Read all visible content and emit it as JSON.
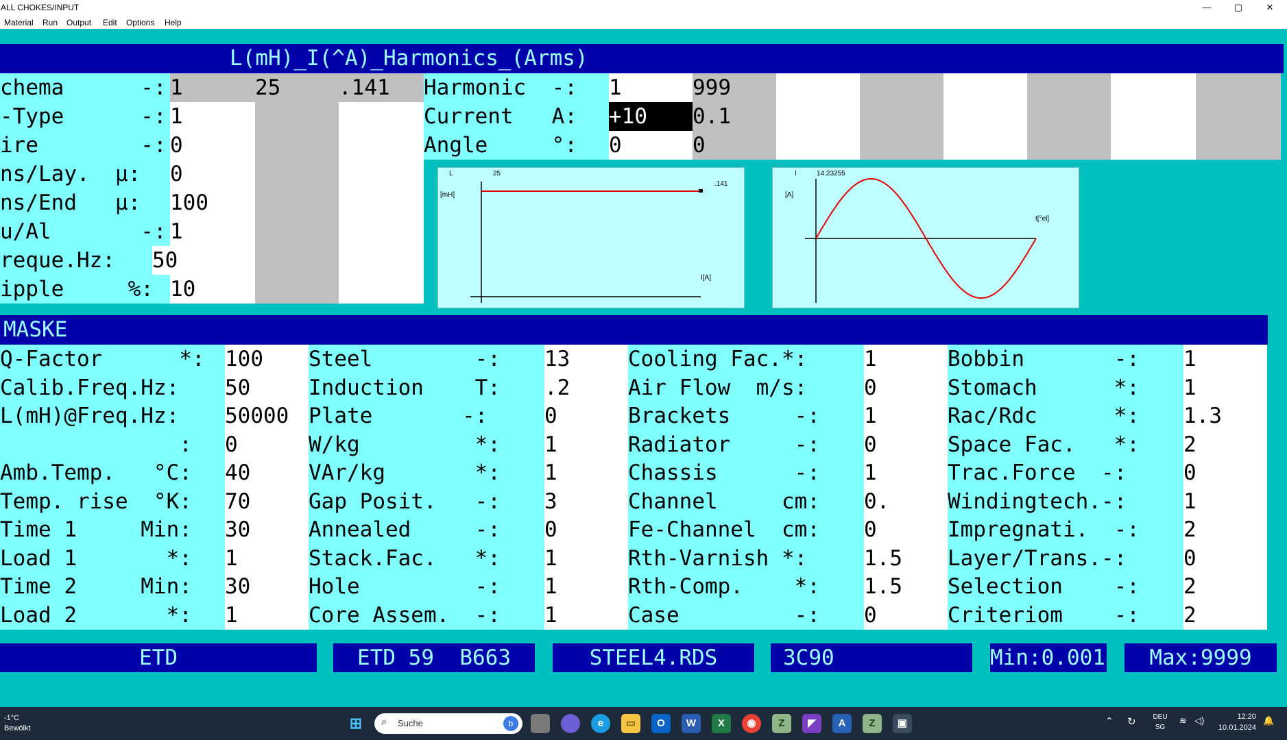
{
  "window": {
    "title": "ALL CHOKES/INPUT",
    "minimize": "—",
    "maximize": "▢",
    "close": "✕"
  },
  "menu": [
    "Material",
    "Run",
    "Output",
    "Edit",
    "Options",
    "Help"
  ],
  "top_section": {
    "title": "L(mH)_I(^A)_Harmonics_(Arms)",
    "rows": [
      {
        "label": "chema      -:",
        "v1": "1",
        "v2": "25",
        "v3": ".141"
      },
      {
        "label": "-Type      -:",
        "v1": "1",
        "v2": "",
        "v3": ""
      },
      {
        "label": "ire        -:",
        "v1": "0",
        "v2": "",
        "v3": ""
      },
      {
        "label": "ns/Lay.  µ:",
        "v1": "0",
        "v2": "",
        "v3": ""
      },
      {
        "label": "ns/End   µ:",
        "v1": "100",
        "v2": "",
        "v3": ""
      },
      {
        "label": "u/Al       -:",
        "v1": "1",
        "v2": "",
        "v3": ""
      },
      {
        "label": "reque.Hz:",
        "v1": "50",
        "v2": "",
        "v3": ""
      },
      {
        "label": "ipple     %:",
        "v1": "10",
        "v2": "",
        "v3": ""
      }
    ],
    "harmonic_rows": [
      {
        "label": "Harmonic  -:",
        "v1": "1",
        "v2": "999"
      },
      {
        "label": "Current   A:",
        "v1": "+10",
        "v2": "0.1"
      },
      {
        "label": "Angle     °:",
        "v1": "0",
        "v2": "0"
      }
    ]
  },
  "charts": {
    "inductance": {
      "ylabel_top": "L",
      "ylabel_unit": "[mH]",
      "top_value": "25",
      "end_value": ".141",
      "xlabel": "I[A]"
    },
    "current": {
      "ylabel_top": "I",
      "ylabel_unit": "[A]",
      "peak_value": "14.23255",
      "xlabel": "t[°el]"
    }
  },
  "mask_section": {
    "title": "MASKE",
    "col1": [
      {
        "label": "Q-Factor      *:",
        "value": "100"
      },
      {
        "label": "Calib.Freq.Hz:",
        "value": "50"
      },
      {
        "label": "L(mH)@Freq.Hz:",
        "value": "50000"
      },
      {
        "label": "              :",
        "value": "0"
      },
      {
        "label": "Amb.Temp.   °C:",
        "value": "40"
      },
      {
        "label": "Temp. rise  °K:",
        "value": "70"
      },
      {
        "label": "Time 1     Min:",
        "value": "30"
      },
      {
        "label": "Load 1       *:",
        "value": "1"
      },
      {
        "label": "Time 2     Min:",
        "value": "30"
      },
      {
        "label": "Load 2       *:",
        "value": "1"
      }
    ],
    "col2": [
      {
        "label": "Steel        -:",
        "value": "13"
      },
      {
        "label": "Induction    T:",
        "value": ".2"
      },
      {
        "label": "Plate       -:",
        "value": "0"
      },
      {
        "label": "W/kg         *:",
        "value": "1"
      },
      {
        "label": "VAr/kg       *:",
        "value": "1"
      },
      {
        "label": "Gap Posit.   -:",
        "value": "3"
      },
      {
        "label": "Annealed     -:",
        "value": "0"
      },
      {
        "label": "Stack.Fac.   *:",
        "value": "1"
      },
      {
        "label": "Hole         -:",
        "value": "1"
      },
      {
        "label": "Core Assem.  -:",
        "value": "1"
      }
    ],
    "col3": [
      {
        "label": "Cooling Fac.*:",
        "value": "1"
      },
      {
        "label": "Air Flow  m/s:",
        "value": "0"
      },
      {
        "label": "Brackets     -:",
        "value": "1"
      },
      {
        "label": "Radiator     -:",
        "value": "0"
      },
      {
        "label": "Chassis      -:",
        "value": "1"
      },
      {
        "label": "Channel     cm:",
        "value": "0."
      },
      {
        "label": "Fe-Channel  cm:",
        "value": "0"
      },
      {
        "label": "Rth-Varnish *:",
        "value": "1.5"
      },
      {
        "label": "Rth-Comp.    *:",
        "value": "1.5"
      },
      {
        "label": "Case         -:",
        "value": "0"
      }
    ],
    "col4": [
      {
        "label": "Bobbin       -:",
        "value": "1"
      },
      {
        "label": "Stomach      *:",
        "value": "1"
      },
      {
        "label": "Rac/Rdc      *:",
        "value": "1.3"
      },
      {
        "label": "Space Fac.   *:",
        "value": "2"
      },
      {
        "label": "Trac.Force  -:",
        "value": "0"
      },
      {
        "label": "Windingtech.-:",
        "value": "1"
      },
      {
        "label": "Impregnati.  -:",
        "value": "2"
      },
      {
        "label": "Layer/Trans.-:",
        "value": "0"
      },
      {
        "label": "Selection    -:",
        "value": "2"
      },
      {
        "label": "Criteriom    -:",
        "value": "2"
      }
    ]
  },
  "status_buttons": [
    "ETD",
    "ETD 59  B663",
    "STEEL4.RDS",
    "3C90",
    "Min:0.001",
    "Max:9999"
  ],
  "taskbar": {
    "weather_temp": "-1°C",
    "weather_desc": "Bewölkt",
    "search_placeholder": "Suche",
    "lang": "DEU",
    "lang_sub": "SG",
    "time": "12:20",
    "date": "10.01.2024"
  },
  "colors": {
    "cyan_bg": "#00BFBF",
    "field_cyan": "#80FFFF",
    "header_blue": "#0000AA",
    "header_text": "#9EFFFF",
    "chart_line": "#E00000"
  }
}
